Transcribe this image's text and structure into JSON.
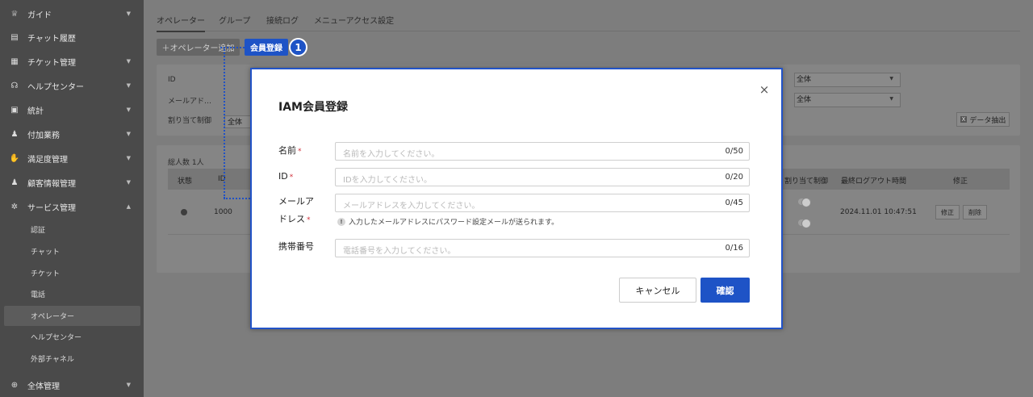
{
  "sidebar": {
    "items": [
      {
        "label": "ガイド",
        "icon": "trophy-icon",
        "glyph": "♕",
        "chevron": "▼"
      },
      {
        "label": "チャット履歴",
        "icon": "chat-icon",
        "glyph": "▤",
        "chevron": ""
      },
      {
        "label": "チケット管理",
        "icon": "ticket-icon",
        "glyph": "▦",
        "chevron": "▼"
      },
      {
        "label": "ヘルプセンター",
        "icon": "headset-icon",
        "glyph": "☊",
        "chevron": "▼"
      },
      {
        "label": "統計",
        "icon": "chart-icon",
        "glyph": "▣",
        "chevron": "▼"
      },
      {
        "label": "付加業務",
        "icon": "user-plus-icon",
        "glyph": "♟",
        "chevron": "▼"
      },
      {
        "label": "満足度管理",
        "icon": "thumbs-up-icon",
        "glyph": "✋",
        "chevron": "▼"
      },
      {
        "label": "顧客情報管理",
        "icon": "customer-icon",
        "glyph": "♟",
        "chevron": "▼"
      },
      {
        "label": "サービス管理",
        "icon": "gear-icon",
        "glyph": "✲",
        "chevron": "▲"
      }
    ],
    "sub_items": [
      "認証",
      "チャット",
      "チケット",
      "電話",
      "オペレーター",
      "ヘルプセンター",
      "外部チャネル"
    ],
    "bottom_item": {
      "label": "全体管理",
      "icon": "plus-circle-icon",
      "glyph": "⊕",
      "chevron": "▼"
    }
  },
  "tabs": [
    "オペレーター",
    "グループ",
    "接続ログ",
    "メニューアクセス設定"
  ],
  "toolbar": {
    "add_operator": "＋オペレーター追加",
    "member_register": "会員登録",
    "step_badge": "1"
  },
  "filters": {
    "id_label": "ID",
    "email_label": "メールアド…",
    "assign_label": "割り当て制御",
    "assign_value": "全体",
    "right_select_1": "全体",
    "right_select_2": "全体",
    "export_label": "データ抽出",
    "export_icon": "X"
  },
  "table": {
    "total": "総人数 1人",
    "headers": {
      "status": "状態",
      "id": "ID",
      "assign": "割り当て制御",
      "logout": "最終ログアウト時間",
      "edit": "修正"
    },
    "row": {
      "id": "1000",
      "logout_time": "2024.11.01 10:47:51",
      "edit_btn": "修正",
      "delete_btn": "削除"
    }
  },
  "modal": {
    "title": "IAM会員登録",
    "close": "×",
    "fields": [
      {
        "label": "名前",
        "required": "*",
        "placeholder": "名前を入力してください。",
        "count": "0/50"
      },
      {
        "label": "ID",
        "required": "*",
        "placeholder": "IDを入力してください。",
        "count": "0/20"
      },
      {
        "label": "メールア",
        "label2": "ドレス",
        "required": "*",
        "placeholder": "メールアドレスを入力してください。",
        "count": "0/45"
      },
      {
        "label": "携帯番号",
        "required": "",
        "placeholder": "電話番号を入力してください。",
        "count": "0/16"
      }
    ],
    "email_hint": "入力したメールアドレスにパスワード設定メールが送られます。",
    "hint_icon": "!",
    "cancel": "キャンセル",
    "confirm": "確認"
  }
}
